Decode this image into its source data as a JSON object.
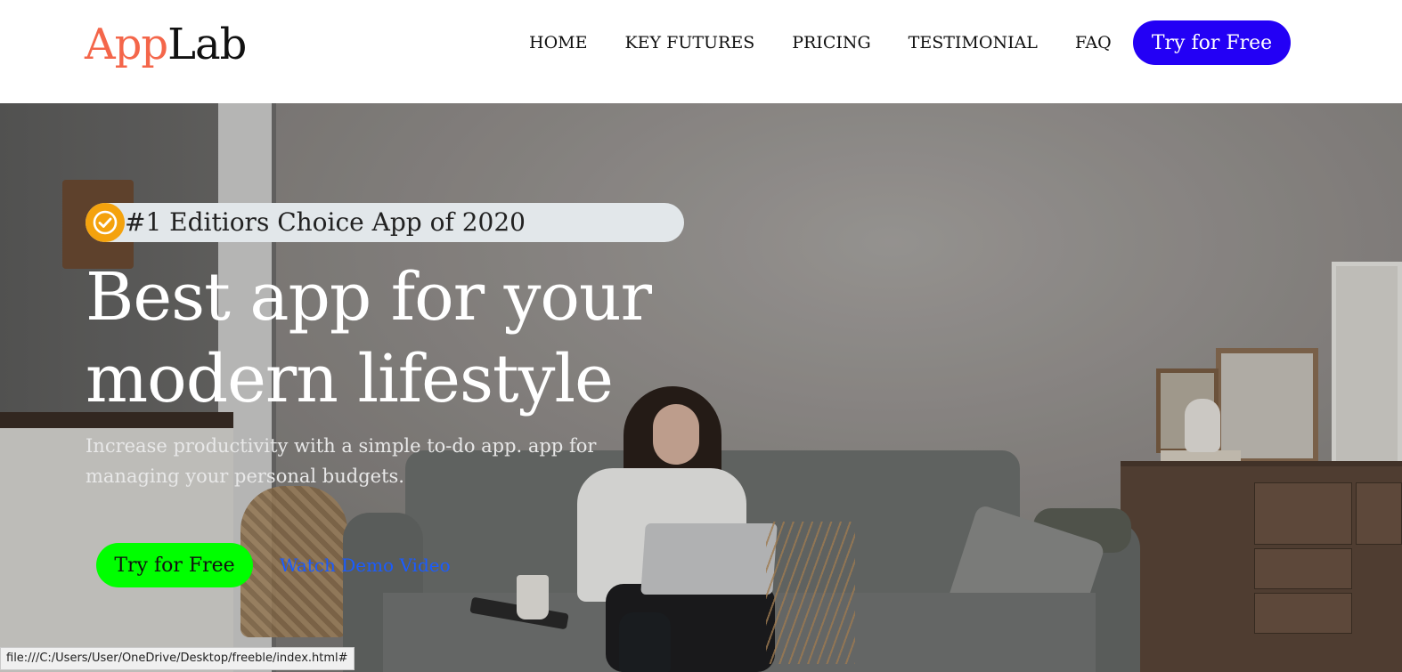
{
  "header": {
    "logo": {
      "part1": "App",
      "part2": "Lab"
    },
    "nav": [
      {
        "label": "HOME"
      },
      {
        "label": "KEY FUTURES"
      },
      {
        "label": "PRICING"
      },
      {
        "label": "TESTIMONIAL"
      },
      {
        "label": "FAQ"
      }
    ],
    "cta_label": "Try for Free"
  },
  "hero": {
    "badge_icon": "check-circle-icon",
    "badge_text": "#1 Editiors Choice App of 2020",
    "title_line1": "Best app for your",
    "title_line2": "modern lifestyle",
    "subtitle": "Increase productivity with a simple to-do app. app for managing your personal budgets.",
    "cta_label": "Try for Free",
    "demo_link": "Watch Demo Video"
  },
  "statusbar": {
    "url": "file:///C:/Users/User/OneDrive/Desktop/freeble/index.html#"
  },
  "colors": {
    "logo_accent": "#f4664a",
    "nav_button": "#2300f5",
    "hero_button": "#00ff00",
    "demo_link": "#1a5cff",
    "badge_icon_bg": "#f4a20d",
    "badge_bg": "#e2e7ea"
  }
}
